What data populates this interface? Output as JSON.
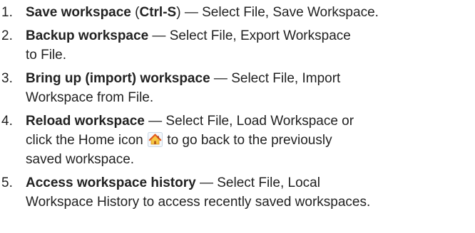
{
  "steps": [
    {
      "number": "1.",
      "title": "Save workspace",
      "shortcut_open": "(",
      "shortcut": "Ctrl-S",
      "shortcut_close": ")",
      "description": "— Select File, Save Workspace."
    },
    {
      "number": "2.",
      "title": "Backup workspace",
      "description_line1": "— Select File, Export Workspace",
      "description_line2": "to File."
    },
    {
      "number": "3.",
      "title": "Bring up (import) workspace",
      "description_line1": "— Select File, Import",
      "description_line2": "Workspace from File."
    },
    {
      "number": "4.",
      "title": "Reload workspace",
      "description_line1": "— Select File, Load Workspace or",
      "description_line2_before_icon": "click the Home icon",
      "icon": "home-icon",
      "description_line2_after_icon": "to go back to the previously",
      "description_line3": "saved workspace."
    },
    {
      "number": "5.",
      "title": "Access workspace history",
      "description_line1": "— Select File, Local",
      "description_line2": "Workspace History to access recently saved workspaces."
    }
  ],
  "colors": {
    "text": "#222222",
    "home_icon_bg": "#f3f7fb",
    "home_icon_roof": "#e45a1f",
    "home_icon_house": "#f6c744"
  }
}
